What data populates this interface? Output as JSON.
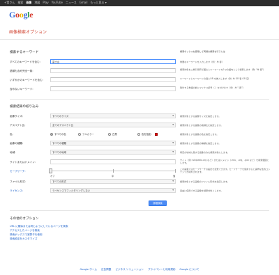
{
  "topbar": {
    "links": [
      "+賢さん",
      "検索",
      "画像",
      "地図",
      "Play",
      "YouTube",
      "ニュース",
      "Gmail",
      "もっと見る ▾"
    ],
    "active_index": 2
  },
  "logo": {
    "letters": [
      "G",
      "o",
      "o",
      "g",
      "l",
      "e"
    ]
  },
  "page_title": "画像検索オプション",
  "keyword_section": {
    "title": "検索するキーワード",
    "hint_header": "検索ボックスを使用して同様の検索を行うには",
    "rows": [
      {
        "label": "すべてのキーワードを含む:",
        "value": "富士山",
        "hint": "重要なキーワードを入力します（例：羊 春）"
      },
      {
        "label": "語順も含め完全一致:",
        "value": "",
        "hint": "検索対象を二重引用符で囲むとキーワードを1つの語句として検索します（例: \"羊 春\"）"
      },
      {
        "label": "いずれかのキーワードを含む:",
        "value": "",
        "hint": "キーワードとキーワードの間にOR を挿入します（例: 羊 OR 春 OR 空）"
      },
      {
        "label": "含めないキーワード:",
        "value": "",
        "hint": "除外する単語の前にマイナス記号（-）を付けます（例: -羊 \"-春\"）"
      }
    ]
  },
  "filter_section": {
    "title": "検索結果の絞り込み",
    "rows": [
      {
        "label": "画像サイズ:",
        "value": "すべてのサイズ",
        "hint": "検索対象とする画像サイズを指定します。"
      },
      {
        "label": "アスペクト比:",
        "value": "全てのアスペクト比",
        "hint": "検索対象とする画像の縦横比を指定します。"
      },
      {
        "label": "色:",
        "radios": [
          "すべての色",
          "フルカラー",
          "白黒",
          "色を指定:"
        ],
        "selected": 0,
        "hint": "検索対象とする画像の色を指定します。"
      },
      {
        "label": "画像の種類:",
        "value": "すべての種類",
        "hint": "検索対象とする画像の種類を指定します。"
      },
      {
        "label": "地域:",
        "value": "すべての地域",
        "hint": "特定の地域に属する画像のみを検索対象にします。"
      },
      {
        "label": "サイトまたはドメイン:",
        "value": "",
        "hint": "サイト（例: wikipedia.org など）またはドメイン（.edu、.org、.gov など）を検索範囲とします。"
      },
      {
        "label": "セーフサーチ:",
        "slider_labels": [
          "オフ",
          "中",
          "強"
        ],
        "hint": "この画面ではセーフサーチの設定を変更できます。セーフサーチを使用すると露骨な性的コンテンツが除外されます。",
        "hint_link": "セーフサーチ"
      },
      {
        "label": "ファイル形式:",
        "value": "すべての形式",
        "hint": "検索対象とする画像のファイル形式を指定します。"
      },
      {
        "label": "ライセンス:",
        "value": "ライセンスでフィルタリングしない",
        "hint": "自由に使用できる画像を検索対象とします。"
      }
    ]
  },
  "submit_label": "詳細検索",
  "other_section": {
    "title": "その他のオプション",
    "links": [
      "URL に類似または同じようにしているページを検索",
      "アクセスしたページを検索",
      "検索ボックスで演算子を使用",
      "検索設定をカスタマイズ"
    ]
  },
  "footer": {
    "links": [
      "Google ホーム",
      "広告掲載",
      "ビジネス ソリューション",
      "プライバシーと利用規約",
      "Google について"
    ]
  },
  "colors": {
    "accent": "#d14836",
    "link": "#1a5fc8",
    "button": "#4b8af4",
    "topbar": "#2d2d2d"
  }
}
